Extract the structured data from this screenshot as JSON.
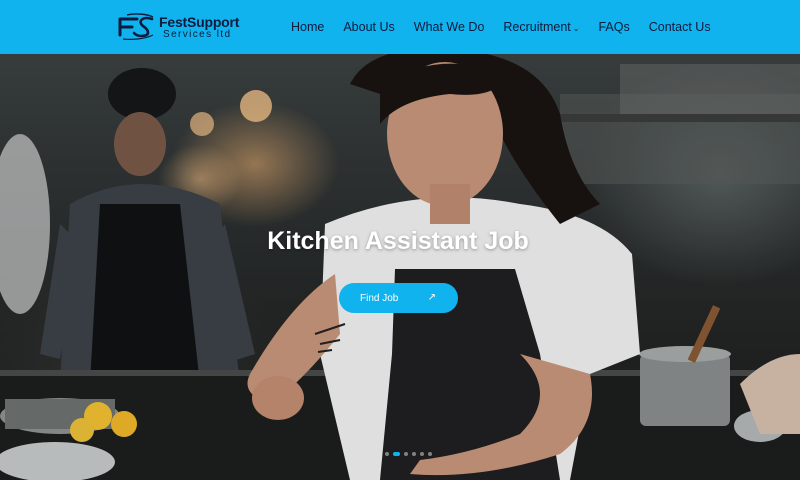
{
  "header": {
    "brand_name": "FestSupport",
    "brand_tagline": "Services ltd",
    "nav": [
      {
        "label": "Home"
      },
      {
        "label": "About Us"
      },
      {
        "label": "What We Do"
      },
      {
        "label": "Recruitment",
        "has_dropdown": true
      },
      {
        "label": "FAQs"
      },
      {
        "label": "Contact Us"
      }
    ]
  },
  "hero": {
    "title": "Kitchen Assistant Job",
    "cta_label": "Find Job",
    "cta_icon": "arrow-up-right-icon",
    "slide_count": 6,
    "active_slide": 1
  },
  "colors": {
    "accent": "#10b3ee",
    "brand_navy": "#0d1b3d",
    "text_light": "#ffffff"
  }
}
